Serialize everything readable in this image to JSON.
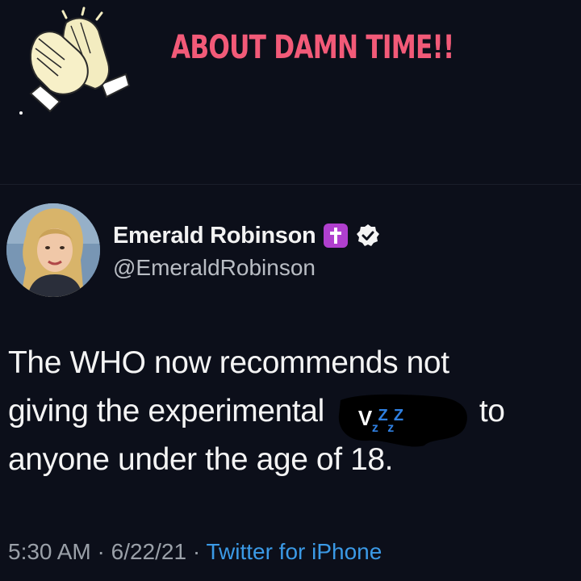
{
  "banner": {
    "headline": "ABOUT DAMN TIME!!",
    "headline_color": "#f25a78",
    "icon": "clapping-hands-icon"
  },
  "tweet": {
    "author_name": "Emerald Robinson",
    "handle": "@EmeraldRobinson",
    "badge_icon": "cross-icon",
    "verified_icon": "verified-check-icon",
    "text_line_1": "The WHO now recommends not",
    "text_line_2_before": "giving the experimental",
    "redacted_word": "V",
    "text_line_2_after": "to",
    "text_line_3": "anyone under the age of 18.",
    "time": "5:30 AM",
    "date": "6/22/21",
    "separator": "·",
    "source": "Twitter for iPhone"
  },
  "colors": {
    "background": "#0c0f1a",
    "link": "#3b9ae6",
    "badge": "#b03fce",
    "headline": "#f25a78"
  }
}
